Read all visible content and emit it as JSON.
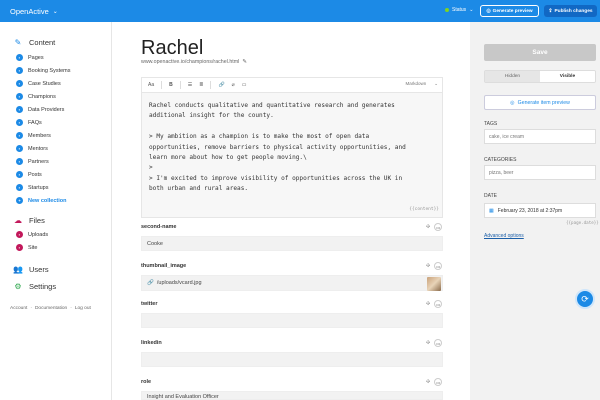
{
  "header": {
    "brand": "OpenActive",
    "status_label": "Status",
    "generate_preview": "Generate preview",
    "publish_changes": "Publish changes"
  },
  "sidebar": {
    "content_title": "Content",
    "items": [
      {
        "label": "Pages"
      },
      {
        "label": "Booking Systems"
      },
      {
        "label": "Case Studies"
      },
      {
        "label": "Champions"
      },
      {
        "label": "Data Providers"
      },
      {
        "label": "FAQs"
      },
      {
        "label": "Members"
      },
      {
        "label": "Mentors"
      },
      {
        "label": "Partners"
      },
      {
        "label": "Posts"
      },
      {
        "label": "Startups"
      }
    ],
    "new_collection": "New collection",
    "files_title": "Files",
    "files": [
      {
        "label": "Uploads"
      },
      {
        "label": "Site"
      }
    ],
    "users_title": "Users",
    "settings_title": "Settings",
    "footer": {
      "account": "Account",
      "dot": "·",
      "documentation": "Documentation",
      "logout": "Log out"
    }
  },
  "document": {
    "title": "Rachel",
    "url": "www.openactive.io/champions/rachel.html",
    "editor_mode": "Markdown",
    "toolbar": {
      "aa": "Aa",
      "bold": "B",
      "ul": "☰",
      "ol": "≣",
      "link": "🔗",
      "unlink": "⌀",
      "image": "▭"
    },
    "body": "Rachel conducts qualitative and quantitative research and generates\nadditional insight for the county.\n\n> My ambition as a champion is to make the most of open data\nopportunities, remove barriers to physical activity opportunities, and\nlearn more about how to get people moving.\\\n>\n> I'm excited to improve visibility of opportunities across the UK in\nboth urban and rural areas.",
    "content_hint": "{{content}}"
  },
  "fields": {
    "second_name": {
      "label": "second-name",
      "value": "Cooke"
    },
    "thumbnail_image": {
      "label": "thumbnail_image",
      "value": "/uploads/vcard.jpg"
    },
    "twitter": {
      "label": "twitter",
      "value": ""
    },
    "linkedin": {
      "label": "linkedin",
      "value": ""
    },
    "role": {
      "label": "role",
      "value": "Insight and Evaluation Officer"
    }
  },
  "right_panel": {
    "save": "Save",
    "hidden": "Hidden",
    "visible": "Visible",
    "generate_item_preview": "Generate item preview",
    "tags_label": "TAGS",
    "tags_value": "cake, ice cream",
    "categories_label": "CATEGORIES",
    "categories_value": "pizza, beer",
    "date_label": "DATE",
    "date_value": "February 23, 2018 at 2:37pm",
    "date_hint": "{{page.date}}",
    "advanced_options": "Advanced options"
  },
  "colors": {
    "accent": "#1c8ae6",
    "files_accent": "#c2185b",
    "status_dot": "#7ed321"
  }
}
